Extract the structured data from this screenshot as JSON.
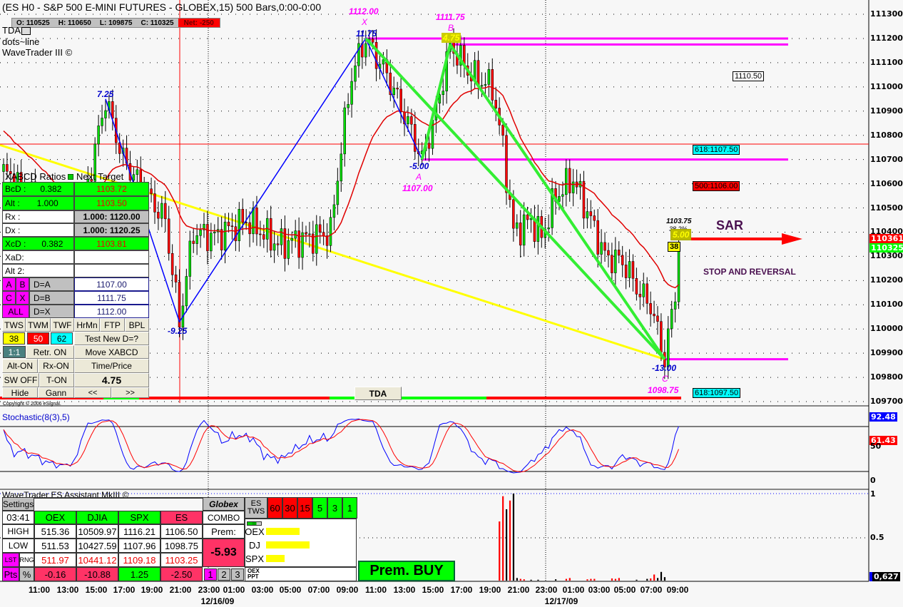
{
  "header": {
    "title": "(ES H0 - S&P 500 E-MINI FUTURES - GLOBEX,15) 500 Bars,0:00-0:00",
    "ohlc": {
      "open": "O: 110525",
      "high": "H: 110650",
      "low": "L: 109875",
      "close": "C: 110325",
      "net": "Net: -250"
    },
    "indicators": [
      "TDA",
      "dots~line",
      "WaveTrader III ©"
    ]
  },
  "colors": {
    "up": "#00cc00",
    "down": "#ff0000",
    "ma": "#e00000",
    "pattern_blue": "#0000ff",
    "pattern_green": "#33ee33",
    "trend_yellow": "#ffff00",
    "level_magenta": "#ff00ff"
  },
  "chart_data": {
    "type": "candlestick",
    "title": "ES H0 15-min",
    "ylim": [
      109700,
      111300
    ],
    "y_ticks": [
      "111300",
      "111200",
      "111100",
      "111000",
      "110900",
      "110800",
      "110700",
      "110600",
      "110500",
      "110400",
      "110300",
      "110200",
      "110100",
      "110000",
      "109900",
      "109800",
      "109700"
    ],
    "x_ticks": [
      "11:00",
      "13:00",
      "15:00",
      "17:00",
      "19:00",
      "21:00",
      "23:00",
      "01:00",
      "03:00",
      "05:00",
      "07:00",
      "09:00",
      "11:00",
      "13:00",
      "15:00",
      "17:00",
      "19:00",
      "21:00",
      "23:00",
      "01:00",
      "03:00",
      "05:00",
      "07:00",
      "09:00"
    ],
    "dates": [
      "12/16/09",
      "12/17/09"
    ],
    "bar_count": 193,
    "price_path": [
      [
        0,
        1106.5
      ],
      [
        11,
        1105.0
      ],
      [
        19,
        1103.0
      ],
      [
        24,
        1106.0
      ],
      [
        29,
        1109.5
      ],
      [
        34,
        1107.0
      ],
      [
        41,
        1105.5
      ],
      [
        46,
        1104.5
      ],
      [
        50,
        1100.3
      ],
      [
        54,
        1104.0
      ],
      [
        60,
        1103.8
      ],
      [
        69,
        1104.5
      ],
      [
        78,
        1103.5
      ],
      [
        88,
        1103.8
      ],
      [
        93,
        1104.0
      ],
      [
        96,
        1107.5
      ],
      [
        99,
        1110.5
      ],
      [
        103,
        1112.0
      ],
      [
        109,
        1110.5
      ],
      [
        115,
        1108.5
      ],
      [
        119,
        1107.0
      ],
      [
        123,
        1109.0
      ],
      [
        127,
        1111.75
      ],
      [
        133,
        1110.5
      ],
      [
        139,
        1110.0
      ],
      [
        142,
        1107.5
      ],
      [
        145,
        1104.0
      ],
      [
        150,
        1104.5
      ],
      [
        153,
        1103.8
      ],
      [
        157,
        1105.5
      ],
      [
        162,
        1106.2
      ],
      [
        167,
        1104.5
      ],
      [
        171,
        1103.0
      ],
      [
        176,
        1102.8
      ],
      [
        181,
        1101.5
      ],
      [
        184,
        1101.0
      ],
      [
        188,
        1098.75
      ],
      [
        191,
        1101.5
      ],
      [
        192,
        1103.25
      ]
    ],
    "pattern": {
      "X": {
        "bar": 103,
        "price": 1112.0
      },
      "A": {
        "bar": 119,
        "price": 1107.0
      },
      "B": {
        "bar": 127,
        "price": 1111.75
      },
      "C": {
        "bar": 188,
        "price": 1098.75
      }
    },
    "pattern_labels": {
      "x_price": "1112.00",
      "x_letter": "X",
      "x_move": "11.75",
      "b_price": "1111.75",
      "b_letter": "B",
      "b_move": "4.75",
      "a_move": "-5.00",
      "a_letter": "A",
      "a_price": "1107.00",
      "swing1": "7.25",
      "swing2": "-9.25",
      "c_move": "-13.00",
      "c_letter": "C",
      "c_price": "1098.75"
    },
    "levels": {
      "l1110": "1110.50",
      "f618a": "618:1107.50",
      "f500": "500:1106.00",
      "f618b": "618:1097.50",
      "proj": "1103.75",
      "proj_pct": "38.2%",
      "proj_box": "5.00",
      "proj_38": "38"
    },
    "last_price": "110325",
    "red_marker": "110361",
    "stochastic": {
      "title": "Stochastic(8(3),5)",
      "k_last": "92.48",
      "d_last": "61.43",
      "ticks": [
        "50",
        "0"
      ]
    },
    "volume": {
      "ticks": [
        "1",
        "0.5"
      ],
      "last": "0,627",
      "bars": [
        [
          141,
          0.68,
          "d"
        ],
        [
          142,
          0.97,
          "d"
        ],
        [
          143,
          0.82,
          "u"
        ],
        [
          144,
          0.92,
          "d"
        ],
        [
          145,
          1.0,
          "u"
        ],
        [
          146,
          0.03,
          "u"
        ],
        [
          147,
          0.02,
          "d"
        ],
        [
          148,
          0.015,
          "d"
        ],
        [
          150,
          0.01,
          "u"
        ],
        [
          152,
          0.01,
          "u"
        ],
        [
          157,
          0.015,
          "u"
        ],
        [
          160,
          0.02,
          "d"
        ],
        [
          161,
          0.03,
          "d"
        ],
        [
          166,
          0.015,
          "d"
        ],
        [
          167,
          0.02,
          "d"
        ],
        [
          168,
          0.02,
          "d"
        ],
        [
          173,
          0.025,
          "d"
        ],
        [
          174,
          0.02,
          "d"
        ],
        [
          175,
          0.03,
          "d"
        ],
        [
          180,
          0.01,
          "u"
        ],
        [
          183,
          0.02,
          "u"
        ],
        [
          184,
          0.025,
          "d"
        ],
        [
          185,
          0.07,
          "d"
        ],
        [
          186,
          0.03,
          "u"
        ],
        [
          187,
          0.1,
          "u"
        ],
        [
          188,
          0.04,
          "u"
        ]
      ]
    }
  },
  "annotations": {
    "sar": "SAR",
    "stop": "STOP AND REVERSAL",
    "tda_button": "TDA",
    "copyright": "Copyright © 2006 eSignal."
  },
  "abcd": {
    "header": "XABCD Ratios",
    "header2": "Next Target",
    "rows": [
      {
        "label": "BcD :",
        "ratio": "0.382",
        "target": "1103.72"
      },
      {
        "label": "Alt  :",
        "ratio": "1.000",
        "target": "1103.50"
      },
      {
        "label": "Rx   :",
        "target": "1.000: 1120.00"
      },
      {
        "label": "Dx   :",
        "target": "1.000: 1120.25"
      },
      {
        "label": "XcD :",
        "ratio": "0.382",
        "target": "1103.81"
      },
      {
        "label": "XaD:"
      },
      {
        "label": "Alt 2:"
      }
    ],
    "points": {
      "a": "A",
      "b": "B",
      "c": "C",
      "x": "X",
      "all": "ALL"
    },
    "d_rows": [
      {
        "label": "D=A",
        "value": "1107.00"
      },
      {
        "label": "D=B",
        "value": "1111.75"
      },
      {
        "label": "D=X",
        "value": "1112.00"
      }
    ],
    "buttons": {
      "tws": "TWS",
      "twm": "TWM",
      "twf": "TWF",
      "hrmn": "HrMn",
      "ftp": "FTP",
      "bpl": "BPL",
      "f38": "38",
      "f50": "50",
      "f62": "62",
      "test": "Test New D=?",
      "ratio": "1:1",
      "retr": "Retr. ON",
      "move": "Move XABCD",
      "alt": "Alt-ON",
      "rx": "Rx-ON",
      "timeprice": "Time/Price",
      "sw": "SW OFF",
      "ton": "T-ON",
      "value": "4.75",
      "hide": "Hide",
      "gann": "Gann",
      "prev": "<<",
      "next": ">>"
    }
  },
  "assistant": {
    "title": "WaveTrader ES Assistant MkIII ©",
    "settings": "Settings",
    "time": "03:41",
    "tf": [
      "5",
      "15",
      "30"
    ],
    "symbols": [
      {
        "name": "OEX",
        "high": "515.36",
        "low": "511.53",
        "last": "511.97",
        "pts": "-0.16"
      },
      {
        "name": "DJIA",
        "high": "10509.97",
        "low": "10427.59",
        "last": "10441.12",
        "pts": "-10.88"
      },
      {
        "name": "SPX",
        "high": "1116.21",
        "low": "1107.96",
        "last": "1109.18",
        "pts": "1.25"
      },
      {
        "name": "ES",
        "high": "1106.50",
        "low": "1098.75",
        "last": "1103.25",
        "pts": "-2.50"
      }
    ],
    "row_labels": {
      "high": "HIGH",
      "low": "LOW",
      "lst": "LST",
      "rng": "RNG",
      "pts": "Pts",
      "pct": "%"
    },
    "globex": "Globex",
    "combo": "COMBO",
    "prem": "Prem:",
    "prem_value": "-5.93",
    "pages": [
      "1",
      "2",
      "3"
    ],
    "es_tws": [
      "ES",
      "TWS"
    ],
    "tws_frames": [
      "60",
      "30",
      "15",
      "5",
      "3",
      "1"
    ],
    "bars": [
      {
        "label": "OEX",
        "level": 0.55
      },
      {
        "label": "DJ",
        "level": 0.72
      },
      {
        "label": "SPX",
        "level": 0.31
      }
    ],
    "ppt": [
      "OEX",
      "PPT"
    ],
    "signal": "Prem. BUY"
  }
}
